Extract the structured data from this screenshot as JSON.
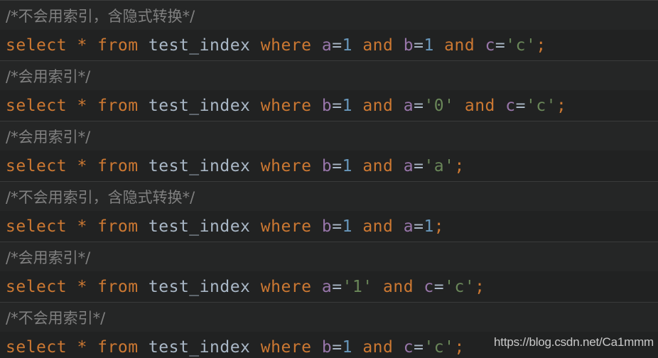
{
  "editor": {
    "background_color": "#212222",
    "comment_row_color": "#252626",
    "separator_color": "#3a3b3b",
    "theme_colors": {
      "keyword": "#cc7832",
      "identifier": "#9876aa",
      "table": "#a9b7c6",
      "number": "#6897bb",
      "string": "#6a8759",
      "operator": "#a9b7c6",
      "comment": "#808080"
    }
  },
  "lines": [
    {
      "type": "comment",
      "text": "/*不会用索引，含隐式转换*/",
      "tokens": [
        {
          "t": "/*不会用索引，含隐式转换*/",
          "c": "cmt"
        }
      ]
    },
    {
      "type": "sql",
      "text": "select * from test_index where a=1 and b=1 and c='c';",
      "tokens": [
        {
          "t": "select",
          "c": "kw"
        },
        {
          "t": " ",
          "c": "op"
        },
        {
          "t": "*",
          "c": "star"
        },
        {
          "t": " ",
          "c": "op"
        },
        {
          "t": "from",
          "c": "kw"
        },
        {
          "t": " ",
          "c": "op"
        },
        {
          "t": "test_index",
          "c": "tbl"
        },
        {
          "t": " ",
          "c": "op"
        },
        {
          "t": "where",
          "c": "kw"
        },
        {
          "t": " ",
          "c": "op"
        },
        {
          "t": "a",
          "c": "id"
        },
        {
          "t": "=",
          "c": "op"
        },
        {
          "t": "1",
          "c": "num"
        },
        {
          "t": " ",
          "c": "op"
        },
        {
          "t": "and",
          "c": "kw"
        },
        {
          "t": " ",
          "c": "op"
        },
        {
          "t": "b",
          "c": "id"
        },
        {
          "t": "=",
          "c": "op"
        },
        {
          "t": "1",
          "c": "num"
        },
        {
          "t": " ",
          "c": "op"
        },
        {
          "t": "and",
          "c": "kw"
        },
        {
          "t": " ",
          "c": "op"
        },
        {
          "t": "c",
          "c": "id"
        },
        {
          "t": "=",
          "c": "op"
        },
        {
          "t": "'c'",
          "c": "str"
        },
        {
          "t": ";",
          "c": "punc"
        }
      ]
    },
    {
      "type": "comment",
      "text": "/*会用索引*/",
      "tokens": [
        {
          "t": "/*会用索引*/",
          "c": "cmt"
        }
      ]
    },
    {
      "type": "sql",
      "text": "select * from test_index where b=1 and a='0' and c='c';",
      "tokens": [
        {
          "t": "select",
          "c": "kw"
        },
        {
          "t": " ",
          "c": "op"
        },
        {
          "t": "*",
          "c": "star"
        },
        {
          "t": " ",
          "c": "op"
        },
        {
          "t": "from",
          "c": "kw"
        },
        {
          "t": " ",
          "c": "op"
        },
        {
          "t": "test_index",
          "c": "tbl"
        },
        {
          "t": " ",
          "c": "op"
        },
        {
          "t": "where",
          "c": "kw"
        },
        {
          "t": " ",
          "c": "op"
        },
        {
          "t": "b",
          "c": "id"
        },
        {
          "t": "=",
          "c": "op"
        },
        {
          "t": "1",
          "c": "num"
        },
        {
          "t": " ",
          "c": "op"
        },
        {
          "t": "and",
          "c": "kw"
        },
        {
          "t": " ",
          "c": "op"
        },
        {
          "t": "a",
          "c": "id"
        },
        {
          "t": "=",
          "c": "op"
        },
        {
          "t": "'0'",
          "c": "str"
        },
        {
          "t": " ",
          "c": "op"
        },
        {
          "t": "and",
          "c": "kw"
        },
        {
          "t": " ",
          "c": "op"
        },
        {
          "t": "c",
          "c": "id"
        },
        {
          "t": "=",
          "c": "op"
        },
        {
          "t": "'c'",
          "c": "str"
        },
        {
          "t": ";",
          "c": "punc"
        }
      ]
    },
    {
      "type": "comment",
      "text": "/*会用索引*/",
      "tokens": [
        {
          "t": "/*会用索引*/",
          "c": "cmt"
        }
      ]
    },
    {
      "type": "sql",
      "text": "select * from test_index where b=1 and a='a';",
      "tokens": [
        {
          "t": "select",
          "c": "kw"
        },
        {
          "t": " ",
          "c": "op"
        },
        {
          "t": "*",
          "c": "star"
        },
        {
          "t": " ",
          "c": "op"
        },
        {
          "t": "from",
          "c": "kw"
        },
        {
          "t": " ",
          "c": "op"
        },
        {
          "t": "test_index",
          "c": "tbl"
        },
        {
          "t": " ",
          "c": "op"
        },
        {
          "t": "where",
          "c": "kw"
        },
        {
          "t": " ",
          "c": "op"
        },
        {
          "t": "b",
          "c": "id"
        },
        {
          "t": "=",
          "c": "op"
        },
        {
          "t": "1",
          "c": "num"
        },
        {
          "t": " ",
          "c": "op"
        },
        {
          "t": "and",
          "c": "kw"
        },
        {
          "t": " ",
          "c": "op"
        },
        {
          "t": "a",
          "c": "id"
        },
        {
          "t": "=",
          "c": "op"
        },
        {
          "t": "'a'",
          "c": "str"
        },
        {
          "t": ";",
          "c": "punc"
        }
      ]
    },
    {
      "type": "comment",
      "text": "/*不会用索引，含隐式转换*/",
      "tokens": [
        {
          "t": "/*不会用索引，含隐式转换*/",
          "c": "cmt"
        }
      ]
    },
    {
      "type": "sql",
      "text": "select * from test_index where b=1 and a=1;",
      "tokens": [
        {
          "t": "select",
          "c": "kw"
        },
        {
          "t": " ",
          "c": "op"
        },
        {
          "t": "*",
          "c": "star"
        },
        {
          "t": " ",
          "c": "op"
        },
        {
          "t": "from",
          "c": "kw"
        },
        {
          "t": " ",
          "c": "op"
        },
        {
          "t": "test_index",
          "c": "tbl"
        },
        {
          "t": " ",
          "c": "op"
        },
        {
          "t": "where",
          "c": "kw"
        },
        {
          "t": " ",
          "c": "op"
        },
        {
          "t": "b",
          "c": "id"
        },
        {
          "t": "=",
          "c": "op"
        },
        {
          "t": "1",
          "c": "num"
        },
        {
          "t": " ",
          "c": "op"
        },
        {
          "t": "and",
          "c": "kw"
        },
        {
          "t": " ",
          "c": "op"
        },
        {
          "t": "a",
          "c": "id"
        },
        {
          "t": "=",
          "c": "op"
        },
        {
          "t": "1",
          "c": "num"
        },
        {
          "t": ";",
          "c": "punc"
        }
      ]
    },
    {
      "type": "comment",
      "text": "/*会用索引*/",
      "tokens": [
        {
          "t": "/*会用索引*/",
          "c": "cmt"
        }
      ]
    },
    {
      "type": "sql",
      "text": "select * from test_index where a='1' and c='c';",
      "tokens": [
        {
          "t": "select",
          "c": "kw"
        },
        {
          "t": " ",
          "c": "op"
        },
        {
          "t": "*",
          "c": "star"
        },
        {
          "t": " ",
          "c": "op"
        },
        {
          "t": "from",
          "c": "kw"
        },
        {
          "t": " ",
          "c": "op"
        },
        {
          "t": "test_index",
          "c": "tbl"
        },
        {
          "t": " ",
          "c": "op"
        },
        {
          "t": "where",
          "c": "kw"
        },
        {
          "t": " ",
          "c": "op"
        },
        {
          "t": "a",
          "c": "id"
        },
        {
          "t": "=",
          "c": "op"
        },
        {
          "t": "'1'",
          "c": "str"
        },
        {
          "t": " ",
          "c": "op"
        },
        {
          "t": "and",
          "c": "kw"
        },
        {
          "t": " ",
          "c": "op"
        },
        {
          "t": "c",
          "c": "id"
        },
        {
          "t": "=",
          "c": "op"
        },
        {
          "t": "'c'",
          "c": "str"
        },
        {
          "t": ";",
          "c": "punc"
        }
      ]
    },
    {
      "type": "comment",
      "text": "/*不会用索引*/",
      "tokens": [
        {
          "t": "/*不会用索引*/",
          "c": "cmt"
        }
      ]
    },
    {
      "type": "sql",
      "text": "select * from test_index where b=1 and c='c';",
      "tokens": [
        {
          "t": "select",
          "c": "kw"
        },
        {
          "t": " ",
          "c": "op"
        },
        {
          "t": "*",
          "c": "star"
        },
        {
          "t": " ",
          "c": "op"
        },
        {
          "t": "from",
          "c": "kw"
        },
        {
          "t": " ",
          "c": "op"
        },
        {
          "t": "test_index",
          "c": "tbl"
        },
        {
          "t": " ",
          "c": "op"
        },
        {
          "t": "where",
          "c": "kw"
        },
        {
          "t": " ",
          "c": "op"
        },
        {
          "t": "b",
          "c": "id"
        },
        {
          "t": "=",
          "c": "op"
        },
        {
          "t": "1",
          "c": "num"
        },
        {
          "t": " ",
          "c": "op"
        },
        {
          "t": "and",
          "c": "kw"
        },
        {
          "t": " ",
          "c": "op"
        },
        {
          "t": "c",
          "c": "id"
        },
        {
          "t": "=",
          "c": "op"
        },
        {
          "t": "'c'",
          "c": "str"
        },
        {
          "t": ";",
          "c": "punc"
        }
      ]
    }
  ],
  "watermark": {
    "text": "https://blog.csdn.net/Ca1mmm"
  }
}
